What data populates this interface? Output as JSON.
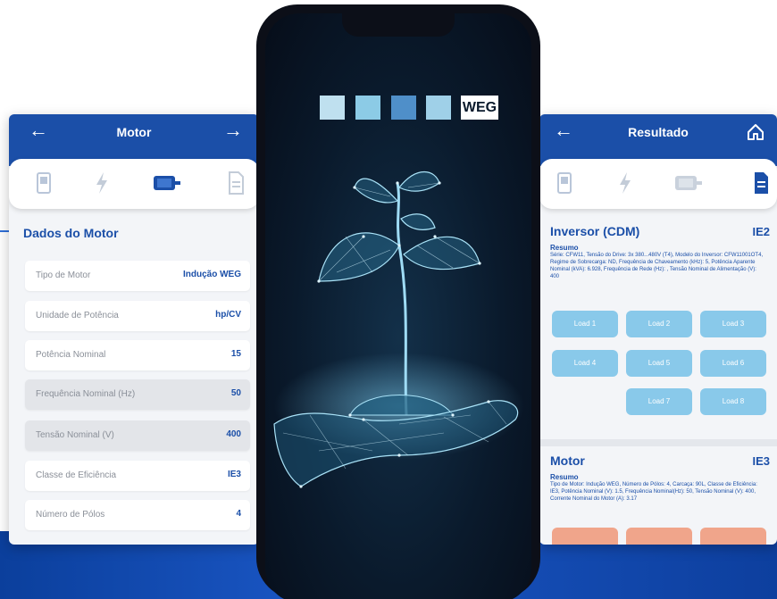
{
  "left_screen": {
    "title": "Motor",
    "back_icon": "arrow-left-icon",
    "forward_icon": "arrow-right-icon",
    "steps": [
      "phone-icon",
      "lightning-icon",
      "motor-icon",
      "document-icon"
    ],
    "section_title": "Dados do Motor",
    "fields": [
      {
        "label": "Tipo de Motor",
        "value": "Indução WEG"
      },
      {
        "label": "Unidade de Potência",
        "value": "hp/CV"
      },
      {
        "label": "Potência Nominal",
        "value": "15"
      },
      {
        "label": "Frequência Nominal (Hz)",
        "value": "50"
      },
      {
        "label": "Tensão Nominal (V)",
        "value": "400"
      },
      {
        "label": "Classe de Eficiência",
        "value": "IE3"
      },
      {
        "label": "Número de Pólos",
        "value": "4"
      }
    ]
  },
  "center_phone": {
    "brand": "WEG",
    "color_squares": [
      "#bfe0ef",
      "#8ccbe6",
      "#4f8fc9",
      "#9fd0e8"
    ]
  },
  "right_screen": {
    "title": "Resultado",
    "back_icon": "arrow-left-icon",
    "home_icon": "home-icon",
    "steps": [
      "phone-icon",
      "lightning-icon",
      "motor-icon",
      "document-icon"
    ],
    "inverter": {
      "title": "Inversor (CDM)",
      "class": "IE2",
      "summary_label": "Resumo",
      "summary": "Série: CFW11, Tensão do Drive: 3x 380...480V (T4), Modelo do Inversor: CFW11001OT4, Regime de Sobrecarga: ND, Frequência de Chaveamento (kHz): 5, Potência Aparente Nominal (kVA): 6.928, Frequência de Rede (Hz): , Tensão Nominal de Alimentação (V): 400"
    },
    "loads": [
      "Load 1",
      "Load 2",
      "Load 3",
      "Load 4",
      "Load 5",
      "Load 6",
      "Load 7",
      "Load 8"
    ],
    "motor": {
      "title": "Motor",
      "class": "IE3",
      "summary_label": "Resumo",
      "summary": "Tipo de Motor: Indução WEG, Número de Pólos: 4, Carcaça: 90L, Classe de Eficiência: IE3, Potência Nominal (V): 1.5, Frequência Nominal(Hz): 50, Tensão Nominal (V): 400, Corrente Nominal do Motor (A): 3.17"
    }
  },
  "colors": {
    "brand_blue": "#1b4fa8",
    "load_button": "#89c9ea",
    "accent_orange": "#f0a58b"
  }
}
